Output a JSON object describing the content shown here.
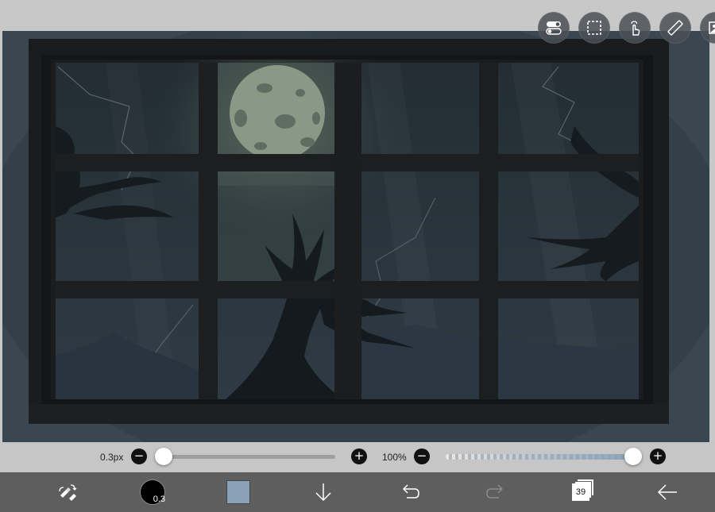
{
  "top_tools": [
    {
      "name": "toggle-icon"
    },
    {
      "name": "selection-icon"
    },
    {
      "name": "touch-icon"
    },
    {
      "name": "ruler-icon"
    },
    {
      "name": "image-icon"
    }
  ],
  "canvas": {
    "background_color": "#37444d",
    "frame_color": "#1c1d1e",
    "moon_color": "#8a9986"
  },
  "slider_row": {
    "brush_size_label": "0.3px",
    "brush_size_fraction": 0.0,
    "opacity_label": "100%",
    "opacity_fraction": 1.0,
    "minus_symbol": "−",
    "plus_symbol": "+"
  },
  "bottom_bar": {
    "tool_icon": "brush-eraser-swap-icon",
    "brush_size_text": "0.3",
    "color": "#8aa1b5",
    "download_icon": "arrow-down-icon",
    "undo_icon": "undo-icon",
    "redo_icon": "redo-icon",
    "layer_count": "39",
    "back_icon": "arrow-left-icon"
  }
}
